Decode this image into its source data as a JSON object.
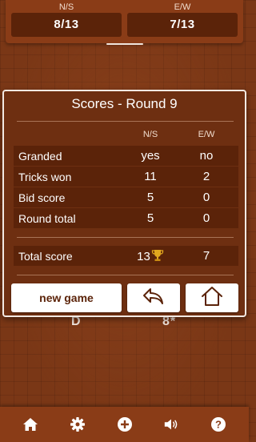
{
  "top_panel": {
    "ns_label": "N/S",
    "ew_label": "E/W",
    "ns_score": "8/13",
    "ew_score": "7/13"
  },
  "background_row": {
    "left_glyph": "D",
    "right_glyph": "8*"
  },
  "dialog": {
    "title": "Scores - Round 9",
    "col_ns": "N/S",
    "col_ew": "E/W",
    "rows": [
      {
        "label": "Granded",
        "ns": "yes",
        "ew": "no"
      },
      {
        "label": "Tricks won",
        "ns": "11",
        "ew": "2"
      },
      {
        "label": "Bid score",
        "ns": "5",
        "ew": "0"
      },
      {
        "label": "Round total",
        "ns": "5",
        "ew": "0"
      }
    ],
    "total": {
      "label": "Total score",
      "ns": "13",
      "ew": "7"
    },
    "buttons": {
      "new_game": "new game",
      "back_icon": "undo-arrow-icon",
      "home_icon": "home-outline-icon"
    }
  },
  "bottom_bar": {
    "icons": [
      "home-icon",
      "gear-icon",
      "plus-icon",
      "sound-icon",
      "help-icon"
    ]
  },
  "colors": {
    "panel": "#8a3c17",
    "dialog": "#6e2f11",
    "row": "#5b2309",
    "trophy": "#e2a71e"
  }
}
